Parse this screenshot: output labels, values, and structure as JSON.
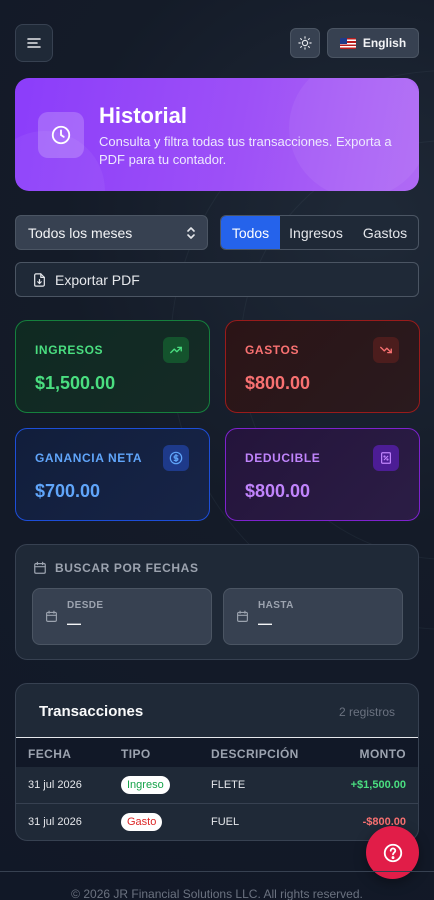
{
  "header": {
    "language_label": "English"
  },
  "hero": {
    "title": "Historial",
    "subtitle": "Consulta y filtra todas tus transacciones. Exporta a PDF para tu contador."
  },
  "filters": {
    "month_value": "Todos los meses",
    "type_tabs": [
      {
        "label": "Todos",
        "active": true
      },
      {
        "label": "Ingresos",
        "active": false
      },
      {
        "label": "Gastos",
        "active": false
      }
    ],
    "export_label": "Exportar PDF"
  },
  "stats": {
    "income": {
      "label": "INGRESOS",
      "value": "$1,500.00"
    },
    "expenses": {
      "label": "GASTOS",
      "value": "$800.00"
    },
    "net": {
      "label": "GANANCIA NETA",
      "value": "$700.00"
    },
    "deductible": {
      "label": "DEDUCIBLE",
      "value": "$800.00"
    }
  },
  "date_search": {
    "title": "BUSCAR POR FECHAS",
    "from_label": "DESDE",
    "from_value": "—",
    "to_label": "HASTA",
    "to_value": "—"
  },
  "transactions": {
    "title": "Transacciones",
    "count": "2 registros",
    "columns": [
      "FECHA",
      "TIPO",
      "DESCRIPCIÓN",
      "MONTO"
    ],
    "rows": [
      {
        "date": "31 jul 2026",
        "type": "Ingreso",
        "description": "FLETE",
        "amount": "+$1,500.00"
      },
      {
        "date": "31 jul 2026",
        "type": "Gasto",
        "description": "FUEL",
        "amount": "-$800.00"
      }
    ]
  },
  "footer": {
    "text": "© 2026 JR Financial Solutions LLC. All rights reserved."
  },
  "colors": {
    "accent_purple": "#8b3dfa",
    "active_tab": "#2563eb",
    "income": "#4ade80",
    "expense": "#f87171",
    "net": "#60a5fa",
    "deductible": "#c084fc",
    "help_button": "#e11d48"
  },
  "icons": {
    "menu": "hamburger-icon",
    "theme": "sun-icon",
    "hero": "clock-icon",
    "export": "file-download-icon",
    "income": "trending-up-icon",
    "expenses": "trending-down-icon",
    "net": "dollar-circle-icon",
    "deductible": "receipt-icon",
    "calendar": "calendar-icon",
    "help": "help-icon"
  }
}
